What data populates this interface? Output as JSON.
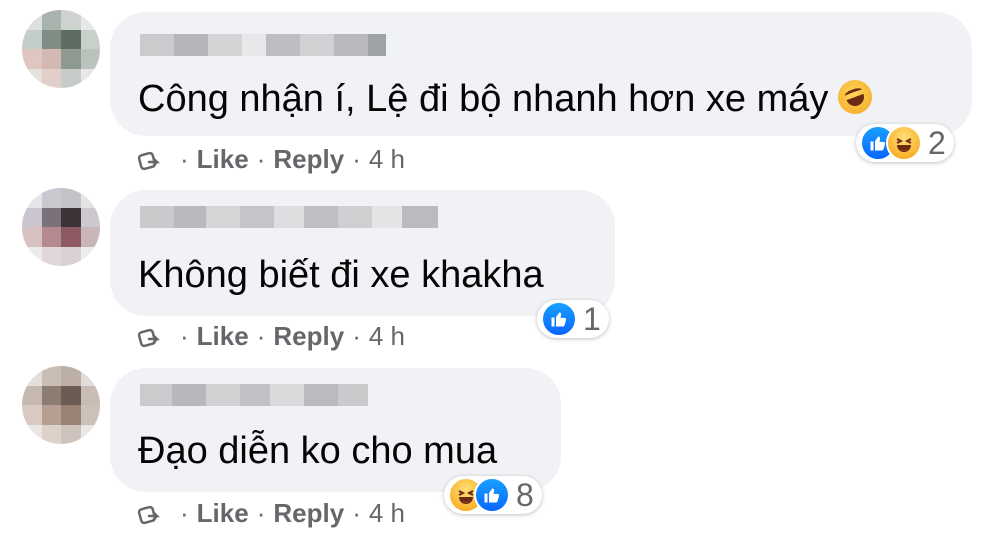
{
  "comments": [
    {
      "text": "Công nhận í, Lệ đi bộ nhanh hơn xe máy",
      "reaction_count": "2",
      "reaction_types": [
        "like-icon",
        "haha-icon"
      ],
      "like_label": "Like",
      "reply_label": "Reply",
      "time": "4 h",
      "separator": "·",
      "trailing_emoji": "rolling-on-floor-laughing-emoji"
    },
    {
      "text": "Không biết đi xe khakha",
      "reaction_count": "1",
      "reaction_types": [
        "like-icon"
      ],
      "like_label": "Like",
      "reply_label": "Reply",
      "time": "4 h",
      "separator": "·"
    },
    {
      "text": "Đạo diễn ko cho mua",
      "reaction_count": "8",
      "reaction_types": [
        "haha-icon",
        "like-icon"
      ],
      "like_label": "Like",
      "reply_label": "Reply",
      "time": "4 h",
      "separator": "·"
    }
  ],
  "colors": {
    "bubble": "#f0f2f5",
    "meta_text": "#65676b",
    "comment_text": "#050505",
    "like_blue": "#0866ff",
    "haha_yellow": "#f6b40c"
  }
}
